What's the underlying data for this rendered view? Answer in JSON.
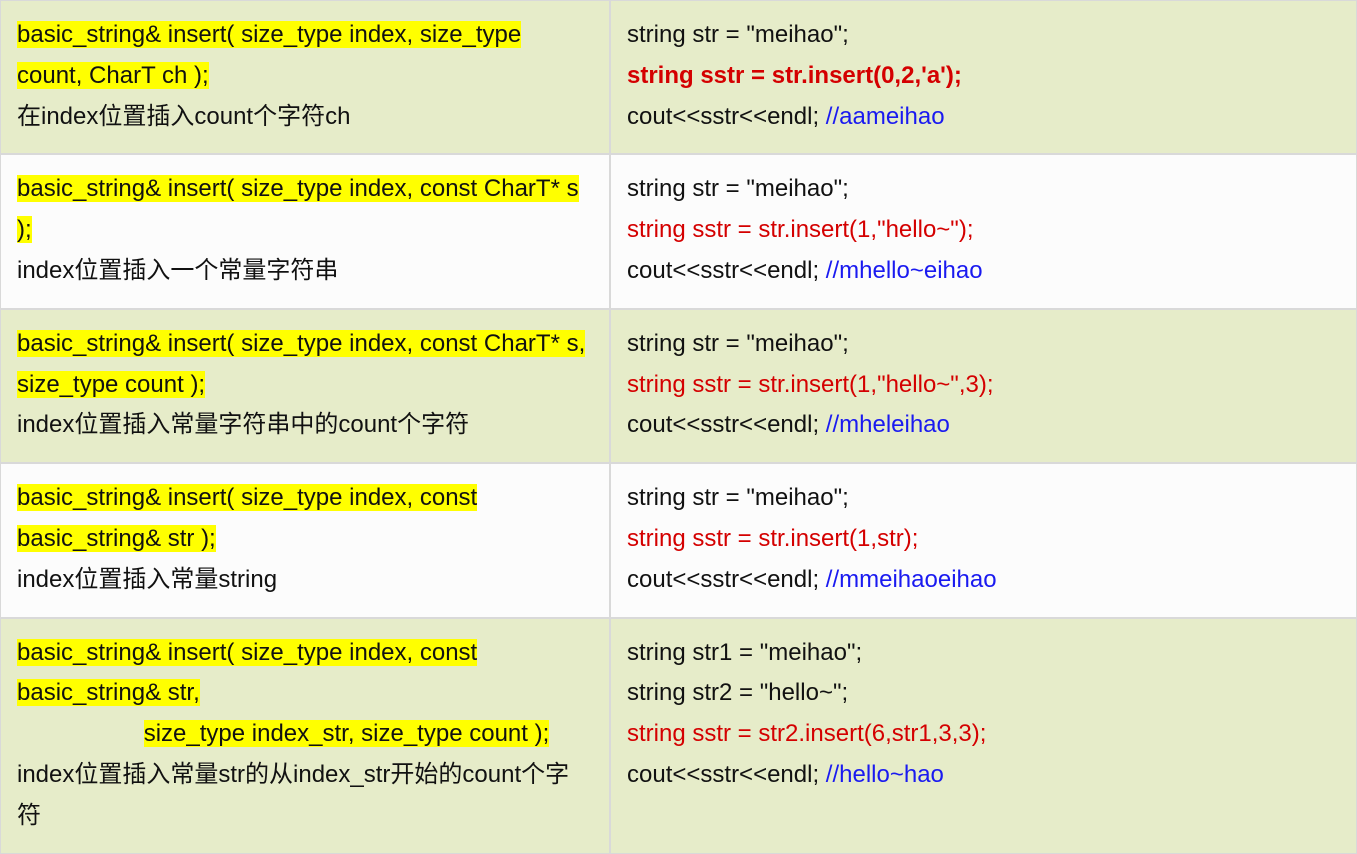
{
  "rows": [
    {
      "sig": "basic_string& insert( size_type index, size_type count, CharT ch );",
      "sig2": "",
      "desc": "在index位置插入count个字符ch",
      "code1": "string str = \"meihao\";",
      "code1b": "",
      "code2": "string sstr = str.insert(0,2,'a');",
      "code2bold": true,
      "code3a": "cout<<sstr<<endl;   ",
      "code3c": "//aameihao"
    },
    {
      "sig": "basic_string& insert( size_type index, const CharT* s );",
      "sig2": "",
      "desc": "index位置插入一个常量字符串",
      "code1": "string str = \"meihao\";",
      "code1b": "",
      "code2": "string sstr = str.insert(1,\"hello~\");",
      "code2bold": false,
      "code3a": "cout<<sstr<<endl;   ",
      "code3c": "//mhello~eihao"
    },
    {
      "sig": "basic_string& insert( size_type index, const CharT* s, size_type count );",
      "sig2": "",
      "desc": "index位置插入常量字符串中的count个字符",
      "code1": "string str = \"meihao\";",
      "code1b": "",
      "code2": "string sstr = str.insert(1,\"hello~\",3);",
      "code2bold": false,
      "code3a": "cout<<sstr<<endl;  ",
      "code3c": "//mheleihao"
    },
    {
      "sig": "basic_string& insert( size_type index, const basic_string& str );",
      "sig2": "",
      "desc": "index位置插入常量string",
      "code1": "string str = \"meihao\";",
      "code1b": "",
      "code2": "string sstr = str.insert(1,str);",
      "code2bold": false,
      "code3a": "cout<<sstr<<endl;  ",
      "code3c": "//mmeihaoeihao"
    },
    {
      "sig": "basic_string& insert( size_type index, const basic_string& str,",
      "sig2": "                   size_type index_str, size_type count );",
      "desc": "index位置插入常量str的从index_str开始的count个字符",
      "code1": "string str1 = \"meihao\";",
      "code1b": "string str2 = \"hello~\";",
      "code2": "string sstr = str2.insert(6,str1,3,3);",
      "code2bold": false,
      "code3a": "cout<<sstr<<endl;  ",
      "code3c": "//hello~hao"
    }
  ]
}
